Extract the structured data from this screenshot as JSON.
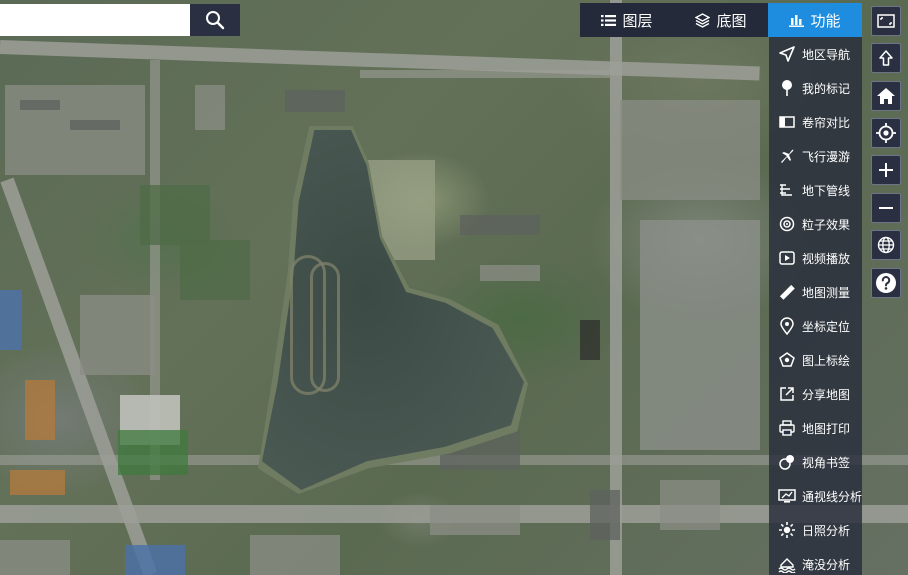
{
  "search": {
    "placeholder": "",
    "value": ""
  },
  "tabs": [
    {
      "label": "图层",
      "icon": "list-icon",
      "active": false
    },
    {
      "label": "底图",
      "icon": "layers-icon",
      "active": false
    },
    {
      "label": "功能",
      "icon": "bar-chart-icon",
      "active": true
    }
  ],
  "menu": {
    "items": [
      {
        "label": "地区导航",
        "icon": "navigation-icon"
      },
      {
        "label": "我的标记",
        "icon": "pin-icon"
      },
      {
        "label": "卷帘对比",
        "icon": "split-compare-icon"
      },
      {
        "label": "飞行漫游",
        "icon": "airplane-icon"
      },
      {
        "label": "地下管线",
        "icon": "pipeline-icon"
      },
      {
        "label": "粒子效果",
        "icon": "particle-icon"
      },
      {
        "label": "视频播放",
        "icon": "video-icon"
      },
      {
        "label": "地图测量",
        "icon": "ruler-icon"
      },
      {
        "label": "坐标定位",
        "icon": "location-icon"
      },
      {
        "label": "图上标绘",
        "icon": "draw-icon"
      },
      {
        "label": "分享地图",
        "icon": "share-icon"
      },
      {
        "label": "地图打印",
        "icon": "printer-icon"
      },
      {
        "label": "视角书签",
        "icon": "bookmark-icon"
      },
      {
        "label": "通视线分析",
        "icon": "monitor-icon"
      },
      {
        "label": "日照分析",
        "icon": "sun-icon"
      },
      {
        "label": "淹没分析",
        "icon": "flood-icon"
      }
    ]
  },
  "tools": [
    {
      "name": "fullscreen-button",
      "icon": "fullscreen-icon"
    },
    {
      "name": "north-button",
      "icon": "arrow-up-icon"
    },
    {
      "name": "home-button",
      "icon": "home-icon"
    },
    {
      "name": "locate-button",
      "icon": "crosshair-icon"
    },
    {
      "name": "zoom-in-button",
      "icon": "plus-icon"
    },
    {
      "name": "zoom-out-button",
      "icon": "minus-icon"
    },
    {
      "name": "globe-button",
      "icon": "globe-icon"
    },
    {
      "name": "help-button",
      "icon": "help-icon"
    }
  ],
  "colors": {
    "accent": "#1e8de0",
    "panel": "#242a3a"
  }
}
